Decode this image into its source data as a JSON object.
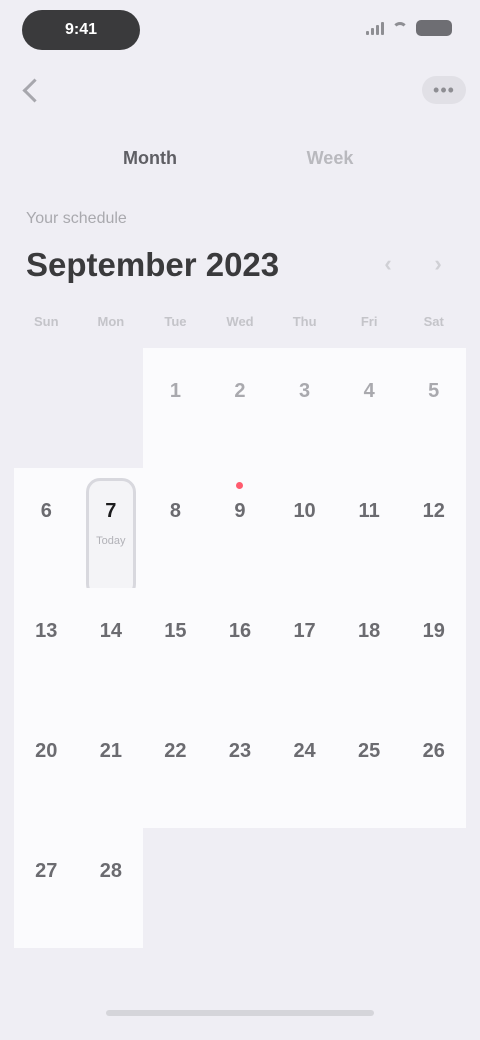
{
  "status_bar": {
    "time": "9:41"
  },
  "tabs": [
    {
      "label": "Month",
      "active": true
    },
    {
      "label": "Week",
      "active": false
    }
  ],
  "month": {
    "subtitle": "Your schedule",
    "title": "September 2023"
  },
  "weekdays": [
    "Sun",
    "Mon",
    "Tue",
    "Wed",
    "Thu",
    "Fri",
    "Sat"
  ],
  "calendar": {
    "leading_blanks": 2,
    "days": [
      "1",
      "2",
      "3",
      "4",
      "5",
      "6",
      "7",
      "8",
      "9",
      "10",
      "11",
      "12",
      "13",
      "14",
      "15",
      "16",
      "17",
      "18",
      "19",
      "20",
      "21",
      "22",
      "23",
      "24",
      "25",
      "26",
      "27",
      "28"
    ],
    "muted_days": [
      "1",
      "2",
      "3",
      "4",
      "5"
    ],
    "selected_day": "7",
    "today_day": "9",
    "selected_tag": "Today"
  },
  "colors": {
    "background": "#efeef4",
    "cell": "#fbfbfd",
    "today_marker": "#ff5b6e"
  }
}
